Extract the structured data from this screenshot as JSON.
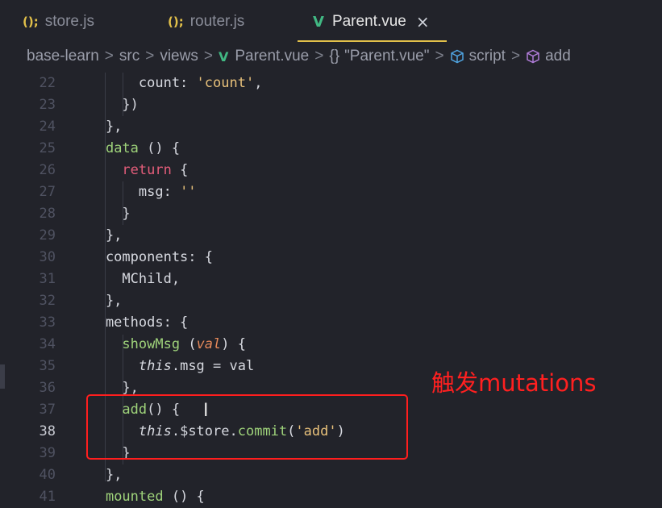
{
  "tabs": [
    {
      "icon": "(){",
      "label": "store.js",
      "active": false
    },
    {
      "icon": "(){",
      "label": "router.js",
      "active": false
    },
    {
      "icon": "V",
      "label": "Parent.vue",
      "active": true,
      "close": "×"
    }
  ],
  "breadcrumb": {
    "items": [
      "base-learn",
      "src",
      "views",
      "Parent.vue",
      "\"Parent.vue\"",
      "script",
      "add"
    ],
    "separator": ">",
    "brace": "{}"
  },
  "code_lines": [
    {
      "n": "22",
      "text": "        count: 'count',"
    },
    {
      "n": "23",
      "text": "      })"
    },
    {
      "n": "24",
      "text": "    },"
    },
    {
      "n": "25",
      "text": "    data () {"
    },
    {
      "n": "26",
      "text": "      return {"
    },
    {
      "n": "27",
      "text": "        msg: ''"
    },
    {
      "n": "28",
      "text": "      }"
    },
    {
      "n": "29",
      "text": "    },"
    },
    {
      "n": "30",
      "text": "    components: {"
    },
    {
      "n": "31",
      "text": "      MChild,"
    },
    {
      "n": "32",
      "text": "    },"
    },
    {
      "n": "33",
      "text": "    methods: {"
    },
    {
      "n": "34",
      "text": "      showMsg (val) {"
    },
    {
      "n": "35",
      "text": "        this.msg = val"
    },
    {
      "n": "36",
      "text": "      },"
    },
    {
      "n": "37",
      "text": "      add() {"
    },
    {
      "n": "38",
      "text": "        this.$store.commit('add')"
    },
    {
      "n": "39",
      "text": "      }"
    },
    {
      "n": "40",
      "text": "    },"
    },
    {
      "n": "41",
      "text": "    mounted () {"
    }
  ],
  "current_line": "38",
  "annotation": {
    "text": "触发mutations",
    "color": "#ff2020"
  },
  "colors": {
    "background": "#22232a",
    "accent_tab": "#e2c04a",
    "vue": "#41b883",
    "keyword": "#e45d7a",
    "function": "#9ed27a",
    "string": "#e7c07a",
    "param": "#e5895a"
  }
}
